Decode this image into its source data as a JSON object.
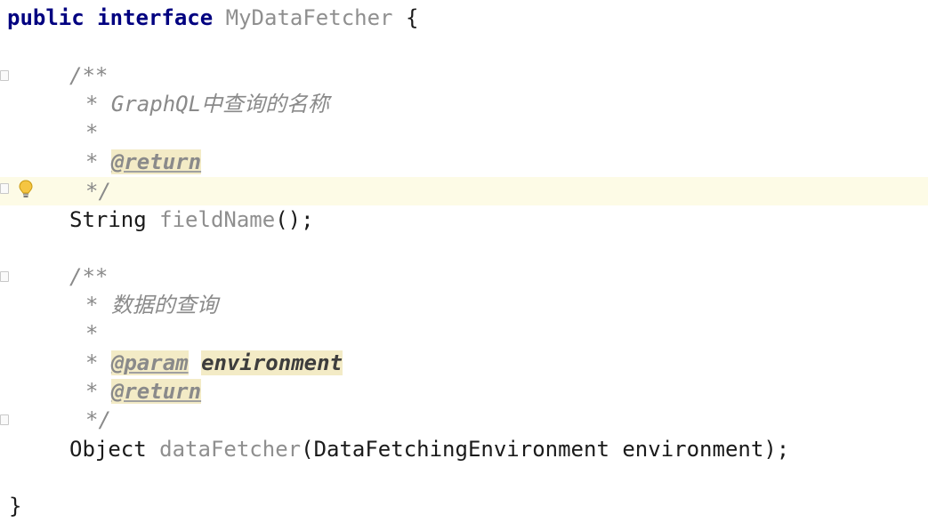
{
  "code": {
    "line1": {
      "kw_public": "public",
      "kw_interface": "interface",
      "name": "MyDataFetcher",
      "brace": "{"
    },
    "doc1": {
      "open": "/**",
      "star_desc": "* ",
      "desc": "GraphQL中查询的名称",
      "star_blank": "*",
      "star_return": "* ",
      "tag_return": "@return",
      "close": "*/"
    },
    "method1": {
      "type": "String",
      "name": "fieldName",
      "rest": "();"
    },
    "doc2": {
      "open": "/**",
      "star_desc": "* ",
      "desc": "数据的查询",
      "star_blank": "*",
      "star_param": "* ",
      "tag_param": "@param",
      "param_name": "environment",
      "star_return": "* ",
      "tag_return": "@return",
      "close": "*/"
    },
    "method2": {
      "type": "Object",
      "name": "dataFetcher",
      "open_paren": "(",
      "param_type": "DataFetchingEnvironment",
      "param_var": "environment",
      "close": ");"
    },
    "closing_brace": "}"
  },
  "gutter": {
    "bulb_icon": "lightbulb-icon",
    "fold_icon": "fold-marker-icon"
  }
}
